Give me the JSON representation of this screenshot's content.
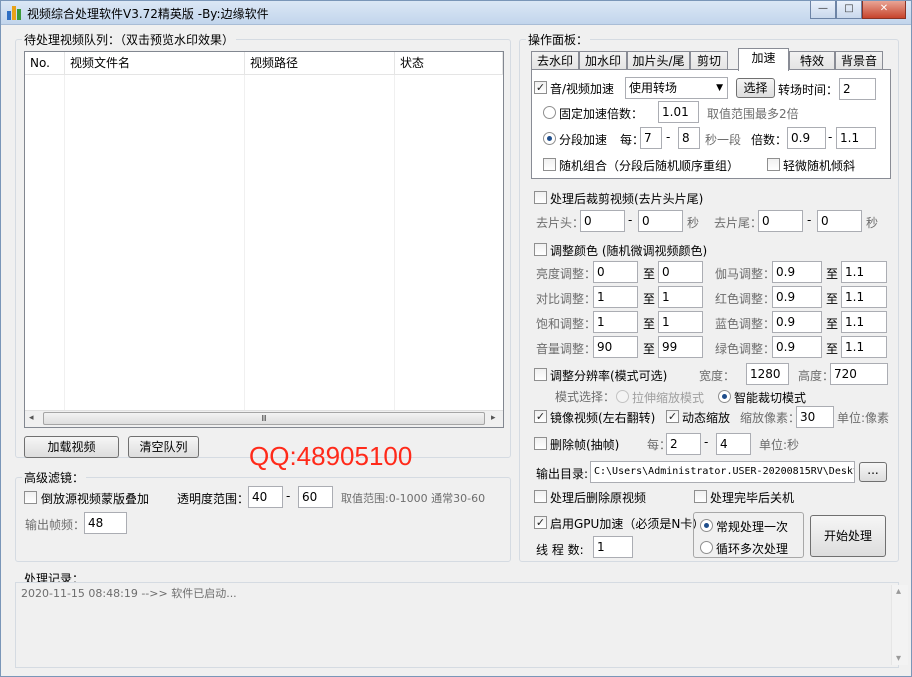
{
  "window": {
    "title": "视频综合处理软件V3.72精英版  -By:边缘软件",
    "min": "—",
    "max": "□",
    "close": "✕"
  },
  "queue": {
    "label": "待处理视频队列：（双击预览水印效果）",
    "columns": [
      "No.",
      "视频文件名",
      "视频路径",
      "状态"
    ],
    "scroll_thumb": "Ⅲ",
    "load_button": "加载视频",
    "clear_button": "清空队列"
  },
  "watermark_text": "QQ:48905100",
  "advanced": {
    "label": "高级滤镜：",
    "reverse_overlay": "倒放源视频蒙版叠加",
    "opacity_label": "透明度范围：",
    "opacity_min": "40",
    "dash": "-",
    "opacity_max": "60",
    "opacity_hint": "取值范围:0-1000 通常30-60",
    "fps_label": "输出帧频：",
    "fps_value": "48"
  },
  "panel": {
    "label": "操作面板：",
    "tabs": [
      "去水印",
      "加水印",
      "加片头/尾",
      "剪切",
      "加速",
      "特效",
      "背景音"
    ],
    "speed": {
      "enable": "音/视频加速",
      "enable_mark": "✓",
      "transition_select": "使用转场",
      "select_button": "选择",
      "transition_time_label": "转场时间：",
      "transition_time": "2",
      "fixed_label": "固定加速倍数：",
      "fixed_value": "1.01",
      "fixed_hint": "取值范围最多2倍",
      "segment_label": "分段加速",
      "every_label": "每：",
      "seg_min": "7",
      "seg_max": "8",
      "seg_unit": "秒一段",
      "ratio_label": "倍数：",
      "ratio_min": "0.9",
      "ratio_max": "1.1",
      "random_combine": "随机组合（分段后随机顺序重组）",
      "slight_tilt": "轻微随机倾斜"
    },
    "trim": {
      "enable": "处理后裁剪视频(去片头片尾)",
      "head_label": "去片头：",
      "head_min": "0",
      "head_max": "0",
      "sec": "秒",
      "tail_label": "去片尾：",
      "tail_min": "0",
      "tail_max": "0"
    },
    "color": {
      "enable": "调整颜色 (随机微调视频颜色)",
      "to": "至",
      "rows": [
        {
          "l_label": "亮度调整：",
          "l_min": "0",
          "l_max": "0",
          "r_label": "伽马调整：",
          "r_min": "0.9",
          "r_max": "1.1"
        },
        {
          "l_label": "对比调整：",
          "l_min": "1",
          "l_max": "1",
          "r_label": "红色调整：",
          "r_min": "0.9",
          "r_max": "1.1"
        },
        {
          "l_label": "饱和调整：",
          "l_min": "1",
          "l_max": "1",
          "r_label": "蓝色调整：",
          "r_min": "0.9",
          "r_max": "1.1"
        },
        {
          "l_label": "音量调整：",
          "l_min": "90",
          "l_max": "99",
          "r_label": "绿色调整：",
          "r_min": "0.9",
          "r_max": "1.1"
        }
      ]
    },
    "resolution": {
      "enable": "调整分辨率(模式可选)",
      "width_label": "宽度：",
      "width": "1280",
      "height_label": "高度：",
      "height": "720",
      "mode_label": "模式选择：",
      "stretch": "拉伸缩放模式",
      "crop": "智能裁切模式"
    },
    "mirror": {
      "enable": "镜像视频(左右翻转)",
      "dynamic": "动态缩放",
      "zoom_label": "缩放像素：",
      "zoom_value": "30",
      "zoom_unit": "单位:像素"
    },
    "dropframe": {
      "enable": "删除帧(抽帧)",
      "every_label": "每：",
      "min": "2",
      "max": "4",
      "unit": "单位:秒"
    },
    "output": {
      "label": "输出目录:",
      "path": "C:\\Users\\Administrator.USER-20200815RV\\Desktop",
      "browse": "..."
    },
    "delete_source": "处理后删除原视频",
    "shutdown": "处理完毕后关机",
    "gpu": "启用GPU加速（必须是N卡）",
    "threads_label": "线 程 数:",
    "threads": "1",
    "normal_once": "常规处理一次",
    "loop_multi": "循环多次处理",
    "start_button": "开始处理"
  },
  "log": {
    "label": "处理记录：",
    "lines": [
      "2020-11-15 08:48:19 -->> 软件已启动..."
    ],
    "scroll_up": "▴",
    "scroll_down": "▾"
  }
}
